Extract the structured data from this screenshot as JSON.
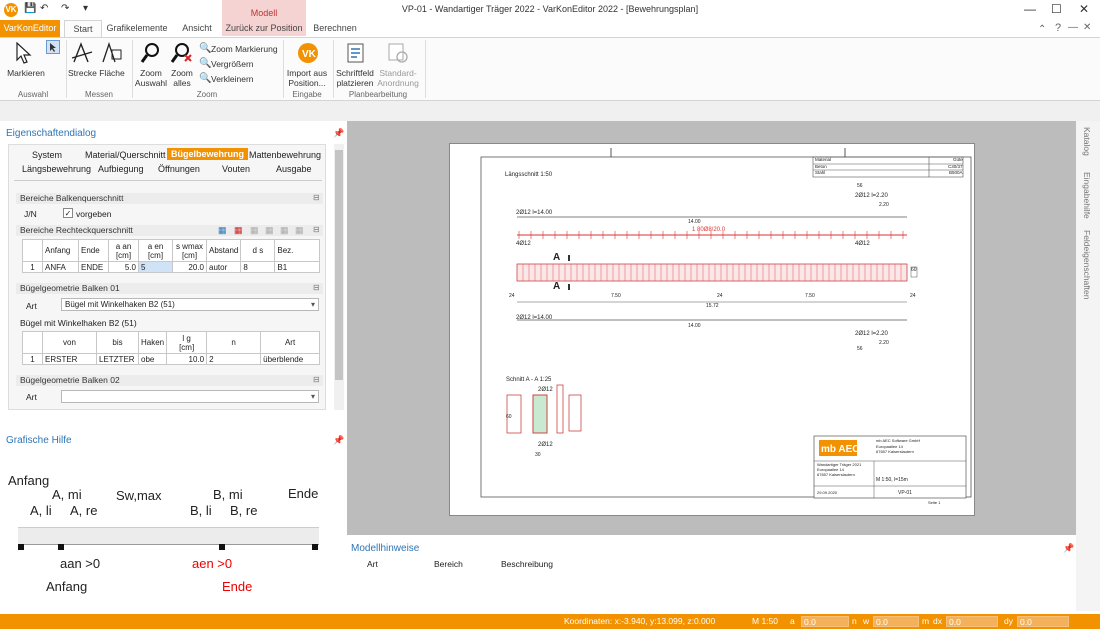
{
  "window": {
    "title": "VP-01 - Wandartiger Träger 2022 - VarKonEditor 2022 - [Bewehrungsplan]",
    "min": "—",
    "max": "☐",
    "close": "✕"
  },
  "context_tab_group": "Modell",
  "tabs": [
    {
      "label": "VarKonEditor"
    },
    {
      "label": "Start"
    },
    {
      "label": "Grafikelemente"
    },
    {
      "label": "Ansicht"
    },
    {
      "label": "Zurück zur Position"
    },
    {
      "label": "Berechnen"
    }
  ],
  "ribbon": {
    "auswahl": {
      "markieren": "Markieren",
      "group": "Auswahl"
    },
    "messen": {
      "strecke": "Strecke",
      "flaeche": "Fläche",
      "group": "Messen"
    },
    "zoom": {
      "auswahl_l1": "Zoom",
      "auswahl_l2": "Auswahl",
      "alles_l1": "Zoom",
      "alles_l2": "alles",
      "markierung": "Zoom Markierung",
      "vergroessern": "Vergrößern",
      "verkleinern": "Verkleinern",
      "group": "Zoom"
    },
    "eingabe": {
      "import_l1": "Import aus",
      "import_l2": "Position...",
      "group": "Eingabe"
    },
    "plan": {
      "schrift_l1": "Schriftfeld",
      "schrift_l2": "platzieren",
      "std_l1": "Standard-",
      "std_l2": "Anordnung",
      "group": "Planbearbeitung"
    }
  },
  "properties": {
    "title": "Eigenschaftendialog",
    "tabs_row1": [
      "System",
      "Material/Querschnitt",
      "Bügelbewehrung",
      "Mattenbewehrung"
    ],
    "tabs_row2": [
      "Längsbewehrung",
      "Aufbiegung",
      "Öffnungen",
      "Vouten",
      "Ausgabe"
    ],
    "sec1": "Bereiche Balkenquerschnitt",
    "jn_label": "J/N",
    "vorgeben": "vorgeben",
    "sec2": "Bereiche Rechteckquerschnitt",
    "t1_head": [
      "",
      "Anfang",
      "Ende",
      "a an\n[cm]",
      "a en\n[cm]",
      "s wmax\n[cm]",
      "Abstand",
      "d s",
      "Bez."
    ],
    "t1_row": [
      "1",
      "ANFA",
      "ENDE",
      "5.0",
      "5",
      "20.0",
      "autor",
      "8",
      "B1"
    ],
    "sec3": "Bügelgeometrie Balken 01",
    "art_label": "Art",
    "art_value": "Bügel mit Winkelhaken B2 (51)",
    "sub3": "Bügel mit Winkelhaken B2 (51)",
    "t2_head": [
      "",
      "von",
      "bis",
      "Haken",
      "l g\n[cm]",
      "n",
      "Art"
    ],
    "t2_row": [
      "1",
      "ERSTER",
      "LETZTER",
      "obe",
      "10.0",
      "2",
      "überblende"
    ],
    "sec4": "Bügelgeometrie Balken 02",
    "art2_label": "Art",
    "art2_value": ""
  },
  "hilfe": {
    "title": "Grafische Hilfe",
    "anfang": "Anfang",
    "a_mi": "A, mi",
    "a_li": "A, li",
    "a_re": "A, re",
    "s_wmax": "Sw,max",
    "b_mi": "B, mi",
    "b_li": "B, li",
    "b_re": "B, re",
    "ende": "Ende",
    "a_an": "aan >0",
    "a_en": "aen >0",
    "anfang2": "Anfang",
    "ende2": "Ende"
  },
  "drawing": {
    "laengsschnitt": "Längsschnitt 1:50",
    "schnitt": "Schnitt A - A 1:25",
    "m1": "Material",
    "m2": "Güte",
    "beton": "Beton",
    "c": "C30/37",
    "stahl": "Stahl",
    "b": "B500A",
    "l1": "2Ø12 l=14.00",
    "l1v": "14.00",
    "stirr": "1  80Ø8/20.0",
    "l3": "2Ø12 l=2.20",
    "l3v": "2.20",
    "left_ø": "4Ø12",
    "right_ø": "4Ø12",
    "d56": "56",
    "dim24a": "24",
    "dim750a": "7.50",
    "dim24b": "24",
    "dim750b": "7.50",
    "dim24c": "24",
    "dim1572": "15.72",
    "l2": "2Ø12 l=14.00",
    "l2v": "14.00",
    "l4": "2Ø12 l=2.20",
    "l4v": "2.20",
    "d56b": "56",
    "cs_top": "2Ø12",
    "cs_bot": "2Ø12",
    "cs_w": "30",
    "cs_h": "60",
    "h60": "60",
    "tb_company": "mb AEC Software GmbH",
    "tb_addr": "Europaallee 14\n67657 Kaiserslautern",
    "tb_proj": "Wandartiger Träger 2021\nEuropaallee 14\n67657 Kaiserslautern",
    "tb_scale": "M 1:50, l=15m",
    "tb_sheet": "VP-01",
    "tb_date": "29.09.2020",
    "footer": "Seite 1"
  },
  "hinweise": {
    "title": "Modellhinweise",
    "cols": [
      "Art",
      "Bereich",
      "Beschreibung"
    ]
  },
  "side_tabs": [
    "Katalog",
    "Eingabehilfe",
    "Feldeigenschaften"
  ],
  "status": {
    "coords": "Koordinaten: x:-3.940, y:13.099, z:0.000",
    "scale": "M 1:50",
    "a": "a",
    "a_val": "0.0",
    "n": "n",
    "w": "w",
    "w_val": "0.0",
    "m": "m",
    "dx": "dx",
    "dx_val": "0.0",
    "dy": "dy",
    "dy_val": "0.0"
  }
}
